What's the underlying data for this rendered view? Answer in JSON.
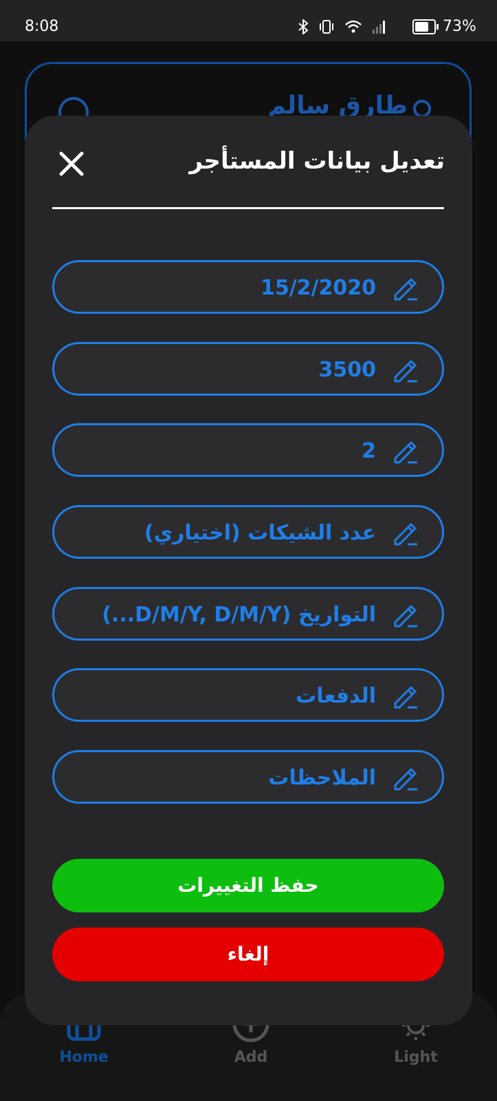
{
  "status_bar": {
    "time": "8:08",
    "battery_percent": "73%",
    "battery_level": 0.73,
    "icons": [
      "bluetooth-icon",
      "vibrate-icon",
      "wifi-icon",
      "signal-icon",
      "battery-icon"
    ]
  },
  "background": {
    "tenant_card": {
      "name": "طارق سالم"
    },
    "nav": [
      {
        "label": "Home",
        "icon": "home-icon",
        "active": true
      },
      {
        "label": "Add",
        "icon": "add-icon",
        "active": false
      },
      {
        "label": "Light",
        "icon": "light-icon",
        "active": false
      }
    ]
  },
  "modal": {
    "title": "تعديل بيانات المستأجر",
    "fields": [
      {
        "value": "15/2/2020",
        "placeholder": ""
      },
      {
        "value": "3500",
        "placeholder": ""
      },
      {
        "value": "2",
        "placeholder": ""
      },
      {
        "value": "",
        "placeholder": "عدد الشيكات (اختياري)"
      },
      {
        "value": "",
        "placeholder": "التواريخ (D/M/Y, D/M/Y...)"
      },
      {
        "value": "",
        "placeholder": "الدفعات"
      },
      {
        "value": "",
        "placeholder": "الملاحظات"
      }
    ],
    "field_display": [
      "15/2/2020",
      "3500",
      "2",
      "عدد الشيكات (اختياري)",
      "التواريخ (D/M/Y, D/M/Y...)",
      "الدفعات",
      "الملاحظات"
    ],
    "save_label": "حفظ التغييرات",
    "cancel_label": "إلغاء"
  },
  "colors": {
    "accent": "#1f7ee8",
    "save": "#0ebe0e",
    "cancel": "#e40000",
    "modal_bg": "#262628"
  }
}
